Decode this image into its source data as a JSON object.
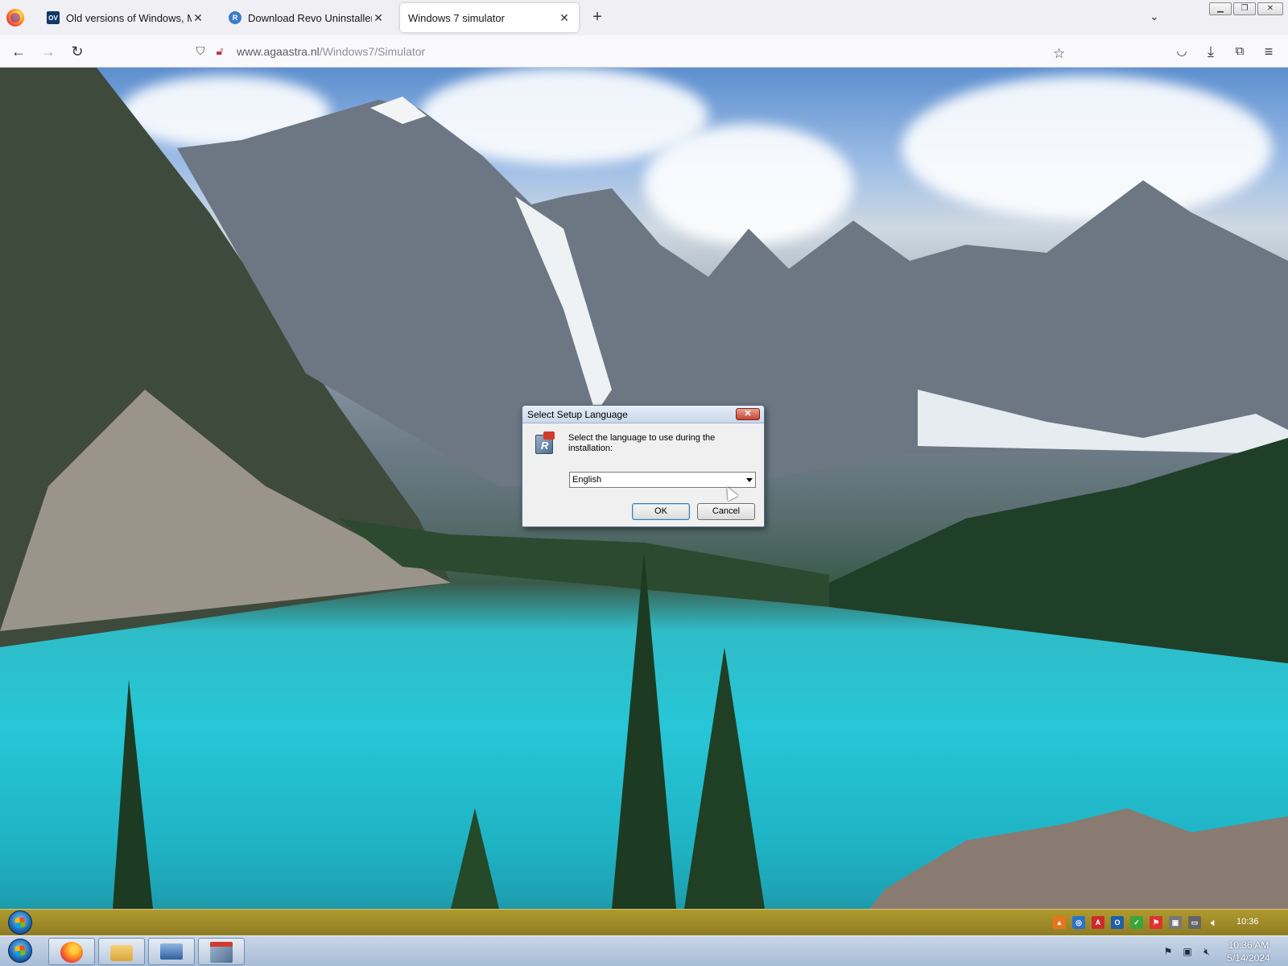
{
  "browser": {
    "tabs": [
      {
        "label": "Old versions of Windows, Mac",
        "favicon": "ov-favicon-icon",
        "active": false
      },
      {
        "label": "Download Revo Uninstaller Free",
        "favicon": "revo-favicon-icon",
        "active": false
      },
      {
        "label": "Windows 7 simulator",
        "favicon": "",
        "active": true
      }
    ],
    "favicon_ov_text": "OV",
    "favicon_revo_text": "R",
    "url_host": "www.agaastra.nl",
    "url_path": "/Windows7/Simulator"
  },
  "dialog": {
    "title": "Select Setup Language",
    "prompt": "Select the language to use during the installation:",
    "selected_language": "English",
    "ok_label": "OK",
    "cancel_label": "Cancel"
  },
  "inner_taskbar": {
    "clock": "10:36"
  },
  "host_taskbar": {
    "time": "10:36 AM",
    "date": "5/14/2024"
  },
  "colors": {
    "inner_taskbar": "#9e8a28",
    "host_taskbar": "#b8c9de",
    "dialog_close": "#c74231"
  }
}
